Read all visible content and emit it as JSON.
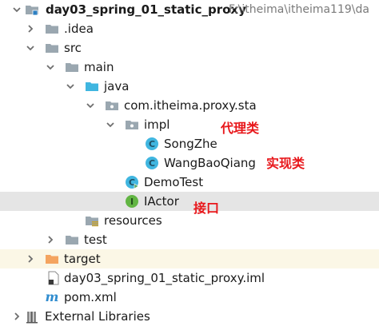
{
  "tree": {
    "root": {
      "name": "day03_spring_01_static_proxy",
      "path": "F:\\itheima\\itheima119\\da"
    },
    "idea": "idea",
    "src": "src",
    "main": "main",
    "java": "java",
    "package": "com.itheima.proxy.sta",
    "impl": "impl",
    "songzhe": "SongZhe",
    "wangbaoqiang": "WangBaoQiang",
    "demotest": "DemoTest",
    "iactor": "IActor",
    "resources": "resources",
    "test": "test",
    "target": "target",
    "iml": "day03_spring_01_static_proxy.iml",
    "pom": "pom.xml",
    "external": "External Libraries"
  },
  "annotations": {
    "proxy_class": "代理类",
    "real_class": "实现类",
    "interface": "接口"
  },
  "icons": {
    "class_badge": "C",
    "interface_badge": "I",
    "maven_badge": "m"
  },
  "colors": {
    "selected_row": "#e5e5e5",
    "annotation_red": "#e8171b",
    "folder_gray": "#9aa7b0",
    "source_folder_blue": "#40b6e0",
    "class_icon": "#40b6e0",
    "interface_icon": "#62b543",
    "excluded_orange": "#f4a460"
  }
}
